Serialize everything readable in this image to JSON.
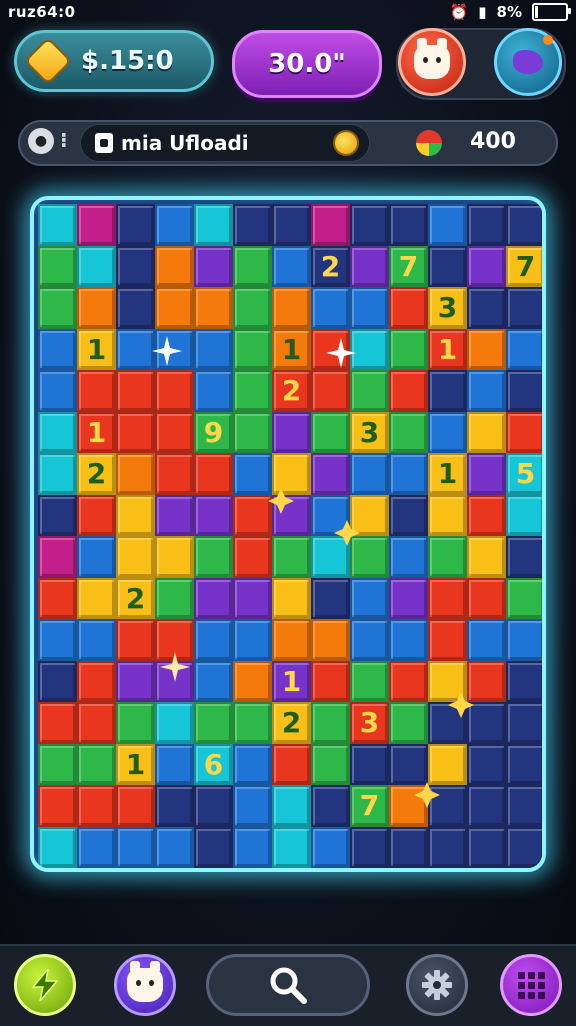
{
  "status_bar": {
    "left_text": "ruz64:0",
    "battery_text": "8%"
  },
  "hud": {
    "coins": "$.15:0",
    "timer": "30.0\"",
    "player_name": "mia Ufloadi",
    "score": "400"
  },
  "board": {
    "rows": [
      [
        "c",
        "m",
        "n",
        "b",
        "c",
        "n",
        "n",
        "m",
        "n",
        "n",
        "b",
        "n",
        "n"
      ],
      [
        "g",
        "c",
        "n",
        "o",
        "p",
        "g",
        "b",
        "n",
        "p",
        "g",
        "n",
        "p",
        "y"
      ],
      [
        "g",
        "o",
        "n",
        "o",
        "o",
        "g",
        "o",
        "b",
        "b",
        "r",
        "y",
        "n",
        "n"
      ],
      [
        "b",
        "y",
        "b",
        "b",
        "b",
        "g",
        "o",
        "r",
        "c",
        "g",
        "r",
        "o",
        "b"
      ],
      [
        "b",
        "r",
        "r",
        "r",
        "b",
        "g",
        "r",
        "r",
        "g",
        "r",
        "n",
        "b",
        "n"
      ],
      [
        "c",
        "r",
        "r",
        "r",
        "g",
        "g",
        "p",
        "g",
        "y",
        "g",
        "b",
        "y",
        "r"
      ],
      [
        "c",
        "y",
        "o",
        "r",
        "r",
        "b",
        "y",
        "p",
        "b",
        "b",
        "y",
        "p",
        "c"
      ],
      [
        "n",
        "r",
        "y",
        "p",
        "p",
        "r",
        "p",
        "b",
        "y",
        "n",
        "y",
        "r",
        "c"
      ],
      [
        "m",
        "b",
        "y",
        "y",
        "g",
        "r",
        "g",
        "c",
        "g",
        "b",
        "g",
        "y",
        "n"
      ],
      [
        "r",
        "y",
        "y",
        "g",
        "p",
        "p",
        "y",
        "n",
        "b",
        "p",
        "r",
        "r",
        "g"
      ],
      [
        "b",
        "b",
        "r",
        "r",
        "b",
        "b",
        "o",
        "o",
        "b",
        "b",
        "r",
        "b",
        "b"
      ],
      [
        "n",
        "r",
        "p",
        "p",
        "b",
        "o",
        "p",
        "r",
        "g",
        "r",
        "y",
        "r",
        "n"
      ],
      [
        "r",
        "r",
        "g",
        "c",
        "g",
        "g",
        "y",
        "g",
        "r",
        "g",
        "n",
        "n",
        "n"
      ],
      [
        "g",
        "g",
        "y",
        "b",
        "c",
        "b",
        "r",
        "g",
        "n",
        "n",
        "y",
        "n",
        "n"
      ],
      [
        "r",
        "r",
        "r",
        "n",
        "n",
        "b",
        "c",
        "n",
        "g",
        "o",
        "n",
        "n",
        "n"
      ],
      [
        "c",
        "b",
        "b",
        "b",
        "n",
        "b",
        "c",
        "b",
        "n",
        "n",
        "n",
        "n",
        "n"
      ]
    ],
    "numbers": [
      {
        "row": 1,
        "col": 7,
        "text": "2"
      },
      {
        "row": 1,
        "col": 9,
        "text": "7"
      },
      {
        "row": 1,
        "col": 12,
        "text": "7"
      },
      {
        "row": 2,
        "col": 10,
        "text": "3"
      },
      {
        "row": 3,
        "col": 1,
        "text": "1"
      },
      {
        "row": 3,
        "col": 6,
        "text": "1"
      },
      {
        "row": 3,
        "col": 10,
        "text": "1"
      },
      {
        "row": 4,
        "col": 6,
        "text": "2"
      },
      {
        "row": 5,
        "col": 1,
        "text": "1"
      },
      {
        "row": 5,
        "col": 4,
        "text": "9"
      },
      {
        "row": 5,
        "col": 8,
        "text": "3"
      },
      {
        "row": 6,
        "col": 1,
        "text": "2"
      },
      {
        "row": 6,
        "col": 10,
        "text": "1"
      },
      {
        "row": 6,
        "col": 12,
        "text": "5"
      },
      {
        "row": 9,
        "col": 2,
        "text": "2"
      },
      {
        "row": 11,
        "col": 6,
        "text": "1"
      },
      {
        "row": 12,
        "col": 6,
        "text": "2"
      },
      {
        "row": 12,
        "col": 8,
        "text": "3"
      },
      {
        "row": 13,
        "col": 2,
        "text": "1"
      },
      {
        "row": 13,
        "col": 4,
        "text": "6"
      },
      {
        "row": 14,
        "col": 8,
        "text": "7"
      }
    ],
    "colors": {
      "r": "#e8361f",
      "o": "#f57a0c",
      "y": "#f8bf17",
      "g": "#2fb84a",
      "b": "#1f74d6",
      "n": "#24357f",
      "p": "#7733c9",
      "c": "#17c6d6",
      "m": "#c21f8a"
    },
    "glow_color": "#8ef4ff"
  },
  "icons": {
    "status": [
      "wifi-icon",
      "battery-icon",
      "signal-icon",
      "alarm-icon"
    ],
    "hud": [
      "gem-icon",
      "pet-avatar",
      "blob-avatar",
      "upload-icon",
      "coin-icon",
      "gift-icon"
    ],
    "bottom": [
      "lightning-icon",
      "pet-icon",
      "search-icon",
      "gear-icon",
      "grid-menu-icon"
    ]
  }
}
